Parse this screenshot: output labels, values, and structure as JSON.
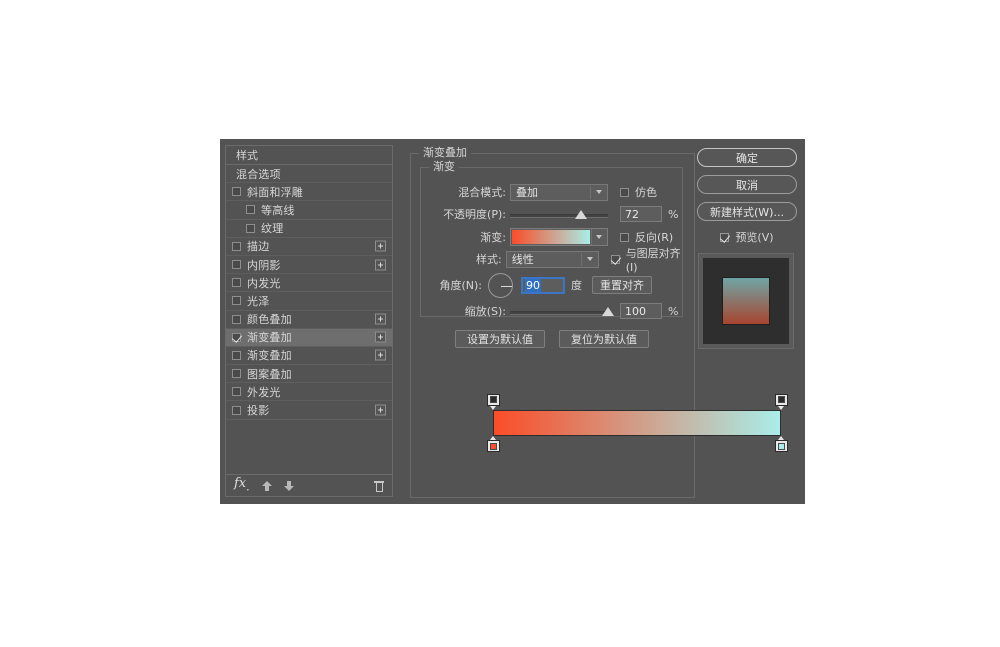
{
  "dialog": {
    "colors": {
      "dialog_bg": "#535353",
      "panel_border": "#6b6b6b",
      "selected_row": "#6e6e6e",
      "text": "#d6d6d6",
      "focus_blue": "#2f6fc4",
      "gradient_start": "#fa4d28",
      "gradient_end": "#a9ede8"
    }
  },
  "styles_panel": {
    "header_label": "样式",
    "blending_options_label": "混合选项",
    "items": [
      {
        "label": "斜面和浮雕",
        "checked": false,
        "indent": false,
        "plus": false
      },
      {
        "label": "等高线",
        "checked": false,
        "indent": true,
        "plus": false
      },
      {
        "label": "纹理",
        "checked": false,
        "indent": true,
        "plus": false
      },
      {
        "label": "描边",
        "checked": false,
        "indent": false,
        "plus": true
      },
      {
        "label": "内阴影",
        "checked": false,
        "indent": false,
        "plus": true
      },
      {
        "label": "内发光",
        "checked": false,
        "indent": false,
        "plus": false
      },
      {
        "label": "光泽",
        "checked": false,
        "indent": false,
        "plus": false
      },
      {
        "label": "颜色叠加",
        "checked": false,
        "indent": false,
        "plus": true
      },
      {
        "label": "渐变叠加",
        "checked": true,
        "indent": false,
        "plus": true,
        "selected": true
      },
      {
        "label": "渐变叠加",
        "checked": false,
        "indent": false,
        "plus": true
      },
      {
        "label": "图案叠加",
        "checked": false,
        "indent": false,
        "plus": false
      },
      {
        "label": "外发光",
        "checked": false,
        "indent": false,
        "plus": false
      },
      {
        "label": "投影",
        "checked": false,
        "indent": false,
        "plus": true
      }
    ],
    "footer": {
      "fx_icon": "fx-icon",
      "move_up_icon": "arrow-up-icon",
      "move_down_icon": "arrow-down-icon",
      "delete_icon": "trash-icon"
    }
  },
  "settings": {
    "group_title": "渐变叠加",
    "subgroup_title": "渐变",
    "blend_mode": {
      "label": "混合模式:",
      "value": "叠加"
    },
    "dither": {
      "label": "仿色",
      "checked": false
    },
    "opacity": {
      "label": "不透明度(P):",
      "value": "72",
      "unit": "%",
      "percent": 72
    },
    "gradient": {
      "label": "渐变:"
    },
    "reverse": {
      "label": "反向(R)",
      "checked": false
    },
    "style": {
      "label": "样式:",
      "value": "线性"
    },
    "align_with_layer": {
      "label": "与图层对齐(I)",
      "checked": true
    },
    "angle": {
      "label": "角度(N):",
      "value": "90",
      "unit": "度",
      "degrees": 90
    },
    "reset_align_button": "重置对齐",
    "scale": {
      "label": "缩放(S):",
      "value": "100",
      "unit": "%",
      "percent": 100
    },
    "set_default_button": "设置为默认值",
    "reset_default_button": "复位为默认值"
  },
  "actions": {
    "ok_label": "确定",
    "cancel_label": "取消",
    "new_style_label": "新建样式(W)...",
    "preview_label": "预览(V)",
    "preview_checked": true
  },
  "gradient_editor": {
    "stops_top": [
      {
        "position": 0,
        "color": "#2b2b2b"
      },
      {
        "position": 100,
        "color": "#2b2b2b"
      }
    ],
    "stops_bottom": [
      {
        "position": 0,
        "color": "#fa4d28"
      },
      {
        "position": 100,
        "color": "#a9ede8"
      }
    ]
  },
  "thumbnail": {
    "top_color": "#6fa5a5",
    "bottom_color": "#a8452f"
  }
}
